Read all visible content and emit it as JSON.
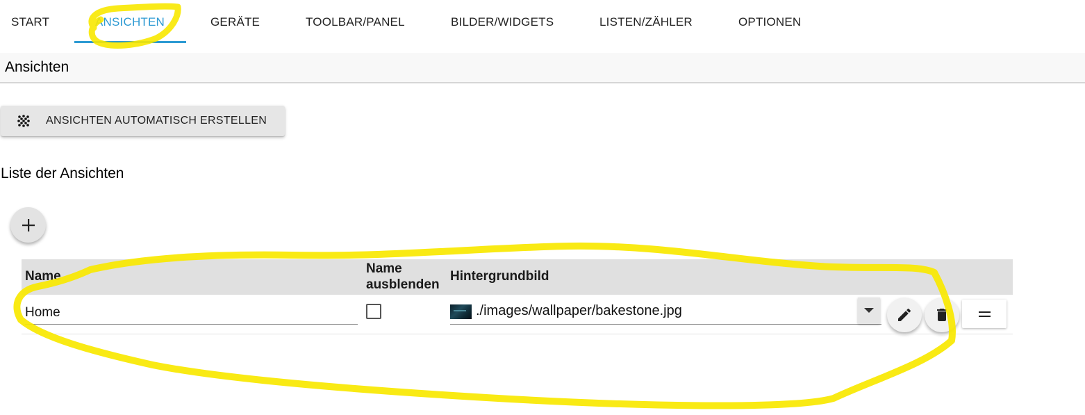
{
  "tabs": [
    {
      "label": "START"
    },
    {
      "label": "ANSICHTEN",
      "active": true
    },
    {
      "label": "GERÄTE"
    },
    {
      "label": "TOOLBAR/PANEL"
    },
    {
      "label": "BILDER/WIDGETS"
    },
    {
      "label": "LISTEN/ZÄHLER"
    },
    {
      "label": "OPTIONEN"
    }
  ],
  "section": {
    "title": "Ansichten"
  },
  "auto_button": {
    "label": "ANSICHTEN AUTOMATISCH ERSTELLEN",
    "icon": "dots-grid-icon"
  },
  "list": {
    "title": "Liste der Ansichten",
    "add_icon": "plus-icon",
    "columns": {
      "name": "Name",
      "hide_name_1": "Name",
      "hide_name_2": "ausblenden",
      "background": "Hintergrundbild"
    },
    "rows": [
      {
        "name": "Home",
        "hide_name": false,
        "background": "./images/wallpaper/bakestone.jpg"
      }
    ]
  },
  "colors": {
    "accent": "#2d9ad3",
    "highlight": "#f8e800",
    "header_bg": "#e0e0e0"
  }
}
